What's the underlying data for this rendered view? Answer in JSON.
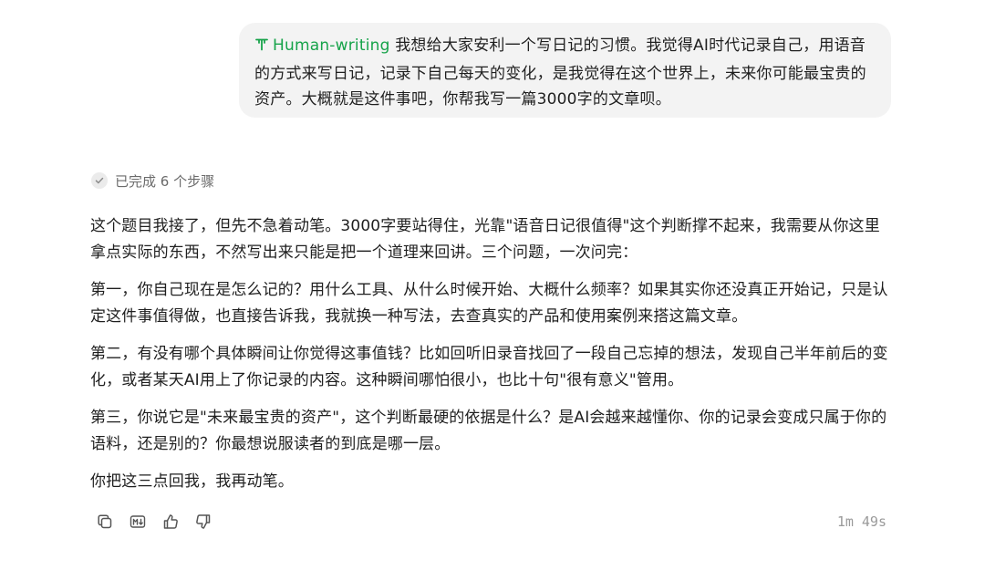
{
  "user_message": {
    "tag": "Human-writing",
    "text": " 我想给大家安利一个写日记的习惯。我觉得AI时代记录自己，用语音的方式来写日记，记录下自己每天的变化，是我觉得在这个世界上，未来你可能最宝贵的资产。大概就是这件事吧，你帮我写一篇3000字的文章呗。",
    "icon": "tag-icon"
  },
  "steps": {
    "label": "已完成 6 个步骤",
    "icon": "check-circle-icon"
  },
  "answer": {
    "paragraphs": [
      "这个题目我接了，但先不急着动笔。3000字要站得住，光靠\"语音日记很值得\"这个判断撑不起来，我需要从你这里拿点实际的东西，不然写出来只能是把一个道理来回讲。三个问题，一次问完：",
      "第一，你自己现在是怎么记的？用什么工具、从什么时候开始、大概什么频率？如果其实你还没真正开始记，只是认定这件事值得做，也直接告诉我，我就换一种写法，去查真实的产品和使用案例来搭这篇文章。",
      "第二，有没有哪个具体瞬间让你觉得这事值钱？比如回听旧录音找回了一段自己忘掉的想法，发现自己半年前后的变化，或者某天AI用上了你记录的内容。这种瞬间哪怕很小，也比十句\"很有意义\"管用。",
      "第三，你说它是\"未来最宝贵的资产\"，这个判断最硬的依据是什么？是AI会越来越懂你、你的记录会变成只属于你的语料，还是别的？你最想说服读者的到底是哪一层。",
      "你把这三点回我，我再动笔。"
    ]
  },
  "actions": {
    "items": [
      {
        "icon": "copy-icon"
      },
      {
        "icon": "markdown-icon"
      },
      {
        "icon": "thumbs-up-icon"
      },
      {
        "icon": "thumbs-down-icon"
      }
    ],
    "elapsed": "1m 49s"
  },
  "colors": {
    "accent": "#17a34a",
    "bubble_bg": "#f3f3f3",
    "muted": "#6b6b6b"
  }
}
